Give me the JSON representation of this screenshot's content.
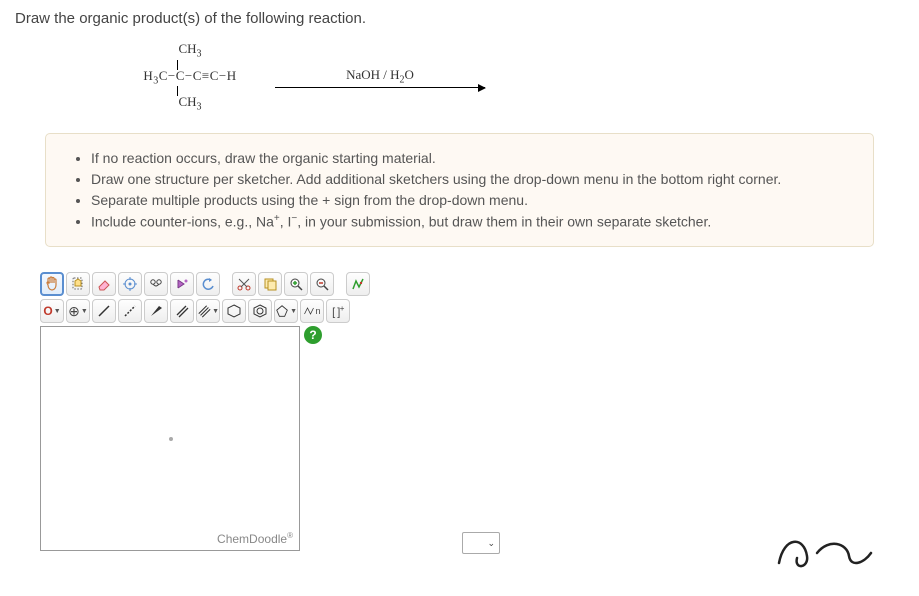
{
  "question": "Draw the organic product(s) of the following reaction.",
  "reaction": {
    "top": "CH₃",
    "mid": "H₃C−C−C≡C−H",
    "bot": "CH₃",
    "reagent": "NaOH / H₂O"
  },
  "instructions": [
    "If no reaction occurs, draw the organic starting material.",
    "Draw one structure per sketcher. Add additional sketchers using the drop-down menu in the bottom right corner.",
    "Separate multiple products using the + sign from the drop-down menu.",
    "Include counter-ions, e.g., Na⁺, I⁻, in your submission, but draw them in their own separate sketcher."
  ],
  "toolbar2": {
    "atom": "O",
    "increase": "⊕",
    "n_label": "n",
    "brackets": "[ ]⁺"
  },
  "help": "?",
  "brand": "ChemDoodle",
  "reg": "®"
}
